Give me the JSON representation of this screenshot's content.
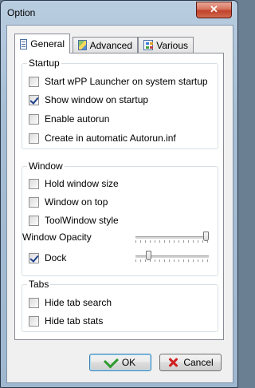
{
  "window": {
    "title": "Option",
    "close_glyph": "✕"
  },
  "tabs": [
    {
      "label": "General",
      "icon": "list-icon"
    },
    {
      "label": "Advanced",
      "icon": "image-icon"
    },
    {
      "label": "Various",
      "icon": "grid-icon"
    }
  ],
  "startup": {
    "title": "Startup",
    "items": [
      {
        "label": "Start wPP Launcher on system startup",
        "checked": false
      },
      {
        "label": "Show window on startup",
        "checked": true
      },
      {
        "label": "Enable autorun",
        "checked": false
      },
      {
        "label": "Create in automatic Autorun.inf",
        "checked": false
      }
    ]
  },
  "window_group": {
    "title": "Window",
    "items": [
      {
        "label": "Hold window size",
        "checked": false
      },
      {
        "label": "Window on top",
        "checked": false
      },
      {
        "label": "ToolWindow style",
        "checked": false
      }
    ],
    "opacity_label": "Window Opacity",
    "opacity_value": 1.0,
    "dock_label": "Dock",
    "dock_checked": true,
    "dock_value": 0.15
  },
  "tabs_group": {
    "title": "Tabs",
    "items": [
      {
        "label": "Hide tab search",
        "checked": false
      },
      {
        "label": "Hide tab stats",
        "checked": false
      }
    ]
  },
  "buttons": {
    "ok": "OK",
    "cancel": "Cancel"
  }
}
